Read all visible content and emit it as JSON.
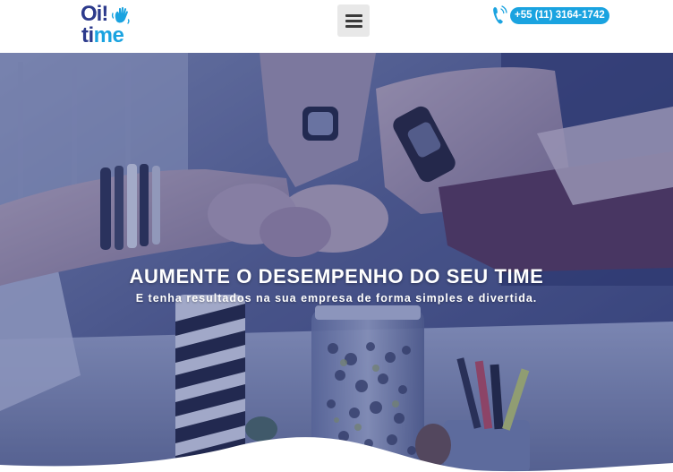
{
  "header": {
    "logo": {
      "line1": "Oi!",
      "line2_part1": "ti",
      "line2_part2": "me",
      "hand_icon": "waving-hand-icon"
    },
    "menu_icon": "hamburger-menu-icon",
    "phone": {
      "icon": "phone-ringing-icon",
      "number": "+55 (11) 3164-1742"
    }
  },
  "hero": {
    "title": "AUMENTE O DESEMPENHO DO SEU TIME",
    "subtitle": "E tenha resultados na sua empresa de forma simples e divertida.",
    "image_description_icon": "team-fist-bump-photo"
  },
  "colors": {
    "brand_dark": "#2c3a8c",
    "brand_light": "#1aa3e0",
    "overlay": "#283882",
    "menu_bg": "#e8e8e8"
  }
}
